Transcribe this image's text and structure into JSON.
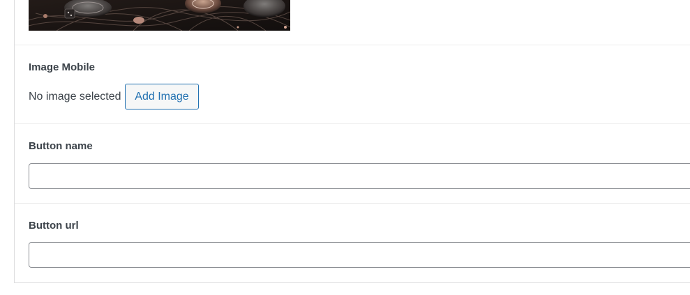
{
  "image_mobile": {
    "label": "Image Mobile",
    "status": "No image selected",
    "add_button": "Add Image"
  },
  "button_name": {
    "label": "Button name",
    "value": "",
    "placeholder": ""
  },
  "button_url": {
    "label": "Button url",
    "value": "",
    "placeholder": ""
  },
  "colors": {
    "accent": "#2271b1",
    "label_text": "#3c434a",
    "border": "#dcdcde",
    "input_border": "#8c8f94"
  }
}
